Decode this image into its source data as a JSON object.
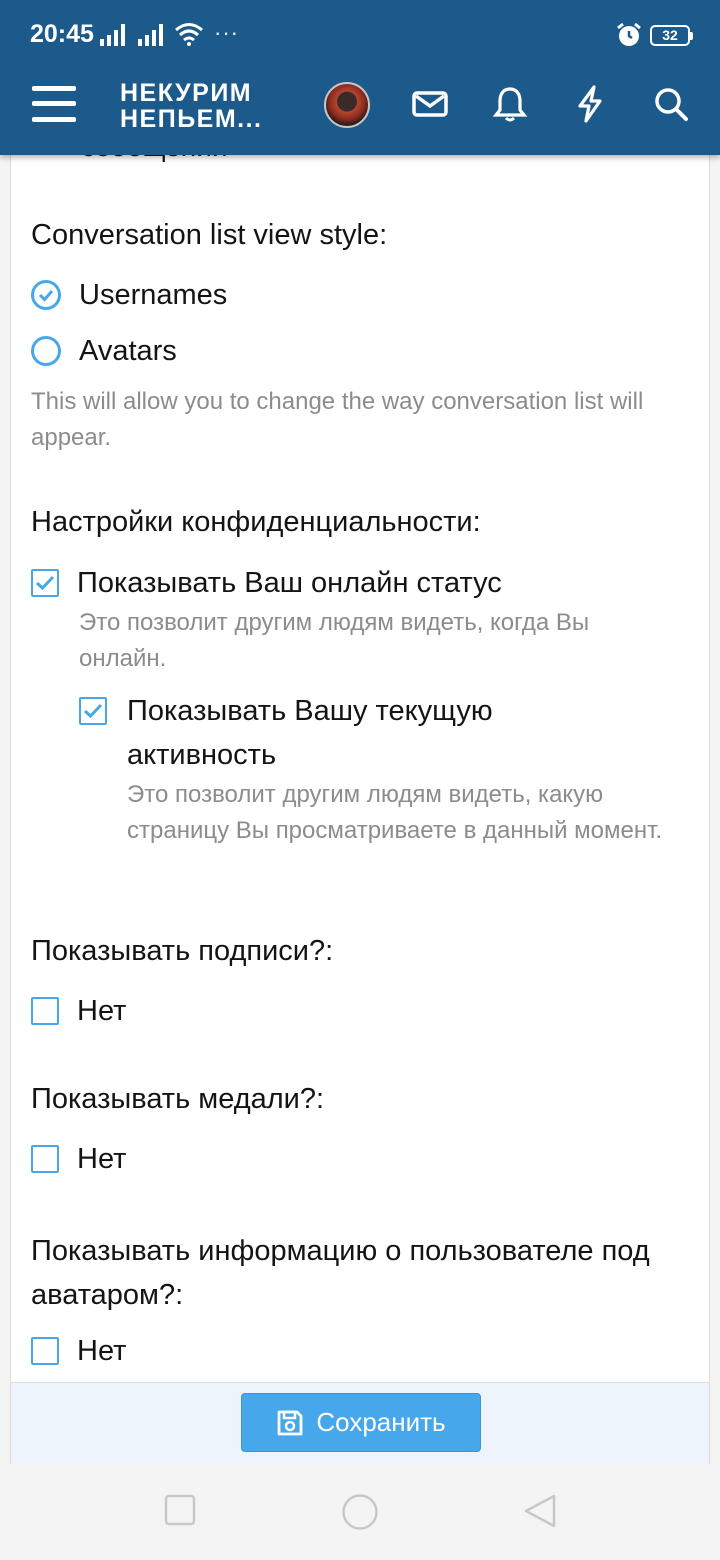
{
  "status_bar": {
    "time": "20:45",
    "more": "···",
    "battery": "32"
  },
  "header": {
    "logo_line1": "НЕКУРИМ",
    "logo_line2": "НЕПЬЕМ...",
    "icons": [
      "menu-icon",
      "avatar",
      "envelope-icon",
      "bell-icon",
      "bolt-icon",
      "search-icon"
    ],
    "accent": "#1d5a8c"
  },
  "content": {
    "cutoff_text": "сообщений",
    "conversation_style": {
      "title": "Conversation list view style:",
      "options": [
        {
          "label": "Usernames",
          "selected": true
        },
        {
          "label": "Avatars",
          "selected": false
        }
      ],
      "hint": "This will allow you to change the way conversation list will appear."
    },
    "privacy": {
      "title": "Настройки конфиденциальности:",
      "online_status": {
        "label": "Показывать Ваш онлайн статус",
        "checked": true,
        "hint": "Это позволит другим людям видеть, когда Вы онлайн."
      },
      "current_activity": {
        "label": "Показывать Вашу текущую активность",
        "checked": true,
        "hint": "Это позволит другим людям видеть, какую страницу Вы просматриваете в данный момент."
      }
    },
    "signatures": {
      "title": "Показывать подписи?:",
      "option": "Нет",
      "checked": false
    },
    "medals": {
      "title": "Показывать медали?:",
      "option": "Нет",
      "checked": false
    },
    "user_info": {
      "title": "Показывать информацию о пользователе под аватаром?:",
      "option": "Нет",
      "checked": false
    }
  },
  "footer": {
    "save_label": "Сохранить",
    "button_color": "#47a7eb"
  }
}
